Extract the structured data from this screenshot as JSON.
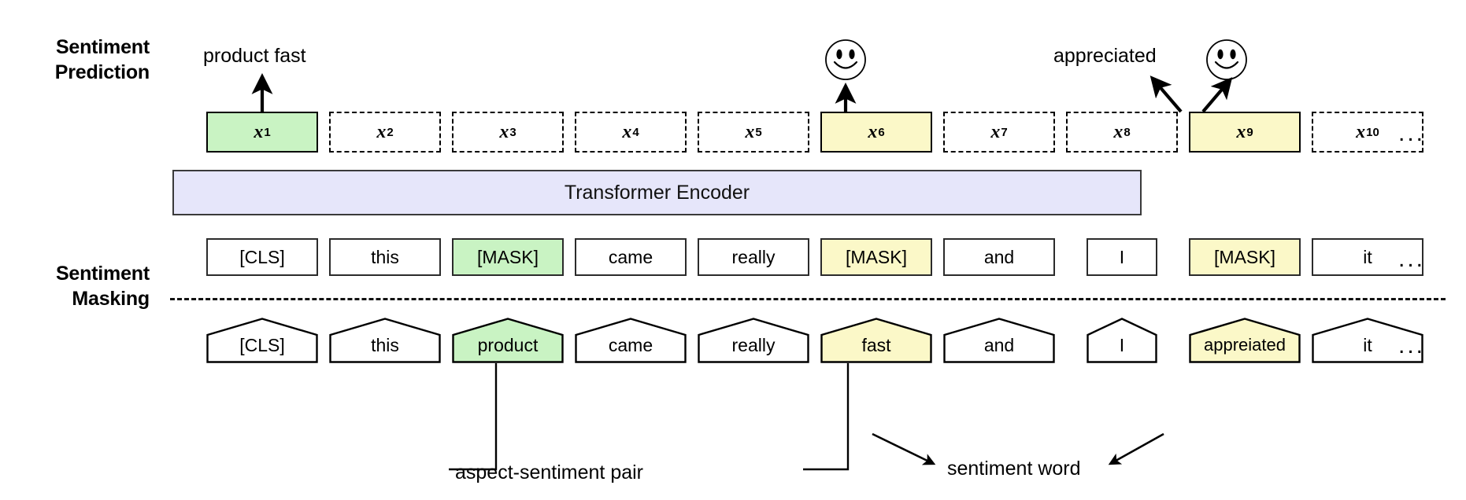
{
  "figure": {
    "title": "Sentiment masking and sentiment prediction diagram",
    "colors": {
      "aspect_green": "#c9f3c3",
      "sentiment_yellow": "#fbf8c8",
      "encoder_lavender": "#e6e6fa",
      "stroke": "#000000"
    }
  },
  "labels": {
    "sentiment_prediction_line1": "Sentiment",
    "sentiment_prediction_line2": "Prediction",
    "sentiment_masking_line1": "Sentiment",
    "sentiment_masking_line2": "Masking"
  },
  "encoder": {
    "name": "Transformer Encoder"
  },
  "predictions": {
    "aspect_prediction_text": "product fast",
    "sentiment_word_prediction_text": "appreciated",
    "smiley_1": "smiley-face",
    "smiley_2": "smiley-face"
  },
  "output_tokens": [
    {
      "var": "x",
      "index": "1",
      "style": "solid",
      "fill": "#c9f3c3"
    },
    {
      "var": "x",
      "index": "2",
      "style": "dashed",
      "fill": "#ffffff"
    },
    {
      "var": "x",
      "index": "3",
      "style": "dashed",
      "fill": "#ffffff"
    },
    {
      "var": "x",
      "index": "4",
      "style": "dashed",
      "fill": "#ffffff"
    },
    {
      "var": "x",
      "index": "5",
      "style": "dashed",
      "fill": "#ffffff"
    },
    {
      "var": "x",
      "index": "6",
      "style": "solid",
      "fill": "#fbf8c8"
    },
    {
      "var": "x",
      "index": "7",
      "style": "dashed",
      "fill": "#ffffff"
    },
    {
      "var": "x",
      "index": "8",
      "style": "dashed",
      "fill": "#ffffff"
    },
    {
      "var": "x",
      "index": "9",
      "style": "solid",
      "fill": "#fbf8c8"
    },
    {
      "var": "x",
      "index": "10",
      "style": "dashed",
      "fill": "#ffffff"
    }
  ],
  "masked_tokens": [
    {
      "text": "[CLS]",
      "fill": "#ffffff"
    },
    {
      "text": "this",
      "fill": "#ffffff"
    },
    {
      "text": "[MASK]",
      "fill": "#c9f3c3"
    },
    {
      "text": "came",
      "fill": "#ffffff"
    },
    {
      "text": "really",
      "fill": "#ffffff"
    },
    {
      "text": "[MASK]",
      "fill": "#fbf8c8"
    },
    {
      "text": "and",
      "fill": "#ffffff"
    },
    {
      "text": "I",
      "fill": "#ffffff"
    },
    {
      "text": "[MASK]",
      "fill": "#fbf8c8"
    },
    {
      "text": "it",
      "fill": "#ffffff"
    }
  ],
  "input_tokens": [
    {
      "text": "[CLS]",
      "fill": "#ffffff"
    },
    {
      "text": "this",
      "fill": "#ffffff"
    },
    {
      "text": "product",
      "fill": "#c9f3c3"
    },
    {
      "text": "came",
      "fill": "#ffffff"
    },
    {
      "text": "really",
      "fill": "#ffffff"
    },
    {
      "text": "fast",
      "fill": "#fbf8c8"
    },
    {
      "text": "and",
      "fill": "#ffffff"
    },
    {
      "text": "I",
      "fill": "#ffffff"
    },
    {
      "text": "appreiated",
      "fill": "#fbf8c8"
    },
    {
      "text": "it",
      "fill": "#ffffff"
    }
  ],
  "annotations": {
    "aspect_sentiment_pair": "aspect-sentiment pair",
    "sentiment_word": "sentiment word",
    "ellipsis": "..."
  }
}
